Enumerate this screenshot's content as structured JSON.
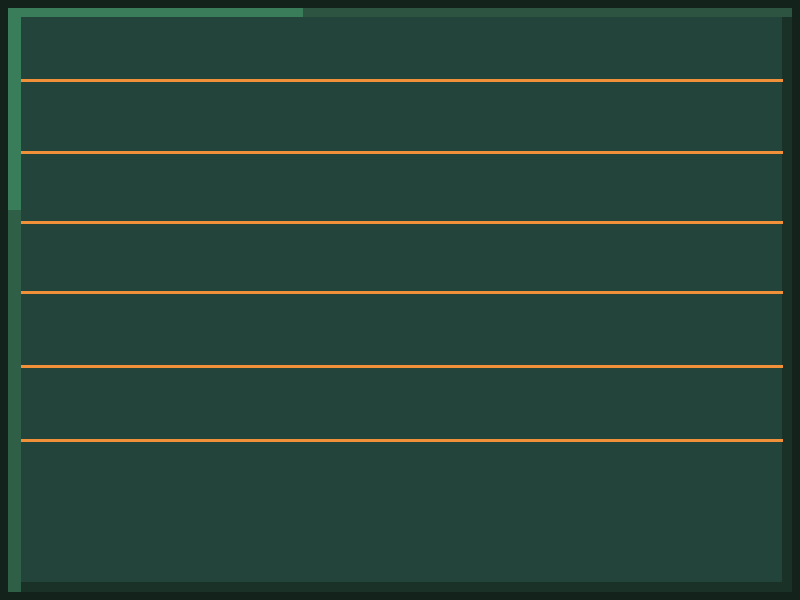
{
  "colors": {
    "background": "#13231b",
    "panel": "#22443a",
    "accent_line": "#f0913a",
    "progress_fill": "#3a7d5a",
    "progress_track": "#2c5440"
  },
  "progress": {
    "horizontal_fraction": 0.376,
    "vertical_fraction": 0.346
  },
  "lines": {
    "count": 6
  }
}
